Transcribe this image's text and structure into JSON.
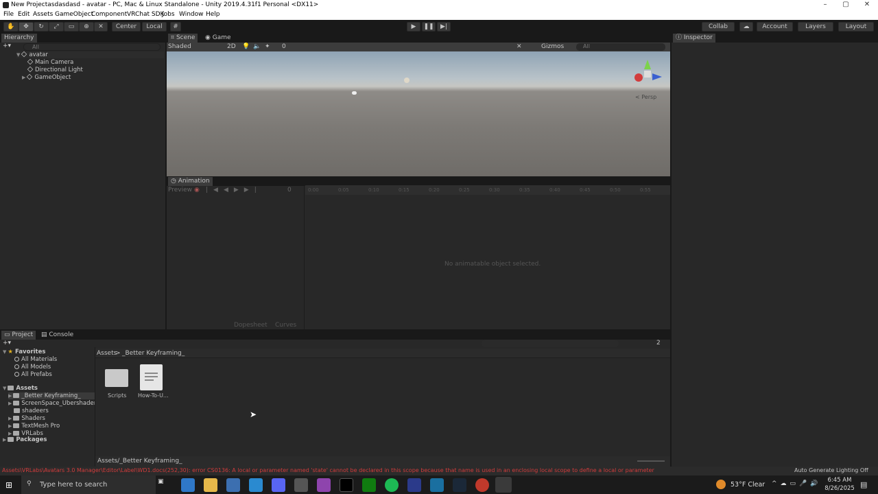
{
  "window": {
    "title": "New Projectasdasdasd - avatar - PC, Mac & Linux Standalone - Unity 2019.4.31f1 Personal <DX11>",
    "min": "–",
    "max": "▢",
    "close": "✕"
  },
  "menu": [
    "File",
    "Edit",
    "Assets",
    "GameObject",
    "Component",
    "VRChat SDK",
    "Jobs",
    "Window",
    "Help"
  ],
  "toolbar": {
    "pivot": "Center",
    "space": "Local",
    "collab": "Collab",
    "account": "Account",
    "layers": "Layers",
    "layout": "Layout"
  },
  "hierarchy": {
    "tab": "Hierarchy",
    "search": "All",
    "root": "avatar",
    "items": [
      "Main Camera",
      "Directional Light",
      "GameObject"
    ]
  },
  "scene_tabs": [
    "Scene",
    "Game"
  ],
  "scene_bar": {
    "mode": "Shaded",
    "dim": "2D",
    "hidden": "0",
    "gizmos": "Gizmos",
    "search": "All"
  },
  "scene": {
    "persp": "< Persp"
  },
  "inspector": {
    "tab": "Inspector"
  },
  "animation": {
    "tab": "Animation",
    "preview": "Preview",
    "frame": "0",
    "empty": "No animatable object selected.",
    "dopesheet": "Dopesheet",
    "curves": "Curves",
    "ticks": [
      "0:00",
      "0:05",
      "0:10",
      "0:15",
      "0:20",
      "0:25",
      "0:30",
      "0:35",
      "0:40",
      "0:45",
      "0:50",
      "0:55"
    ]
  },
  "project": {
    "tabs": [
      "Project",
      "Console"
    ],
    "favorites": "Favorites",
    "fav_items": [
      "All Materials",
      "All Models",
      "All Prefabs"
    ],
    "assets": "Assets",
    "asset_items": [
      "_Better Keyframing_",
      "ScreenSpace_Ubershader-m",
      "shadeers",
      "Shaders",
      "TextMesh Pro",
      "VRLabs"
    ],
    "packages": "Packages",
    "breadcrumb": [
      "Assets",
      ">",
      "_Better Keyframing_"
    ],
    "files": [
      "Scripts",
      "How-To-U..."
    ],
    "path": "Assets/_Better Keyframing_",
    "badge": "2"
  },
  "status": {
    "error": "Assets\\VRLabs\\Avatars 3.0 Manager\\Editor\\Label\\WD1.docs(252,30): error CS0136: A local or parameter named 'state' cannot be declared in this scope because that name is used in an enclosing local scope to define a local or parameter",
    "right": "Auto Generate Lighting Off"
  },
  "taskbar": {
    "search": "Type here to search",
    "weather": "53°F  Clear",
    "time": "6:45 AM",
    "date": "8/26/2025"
  },
  "colors": {
    "accent": "#3a72b0",
    "error": "#d23c3c"
  }
}
